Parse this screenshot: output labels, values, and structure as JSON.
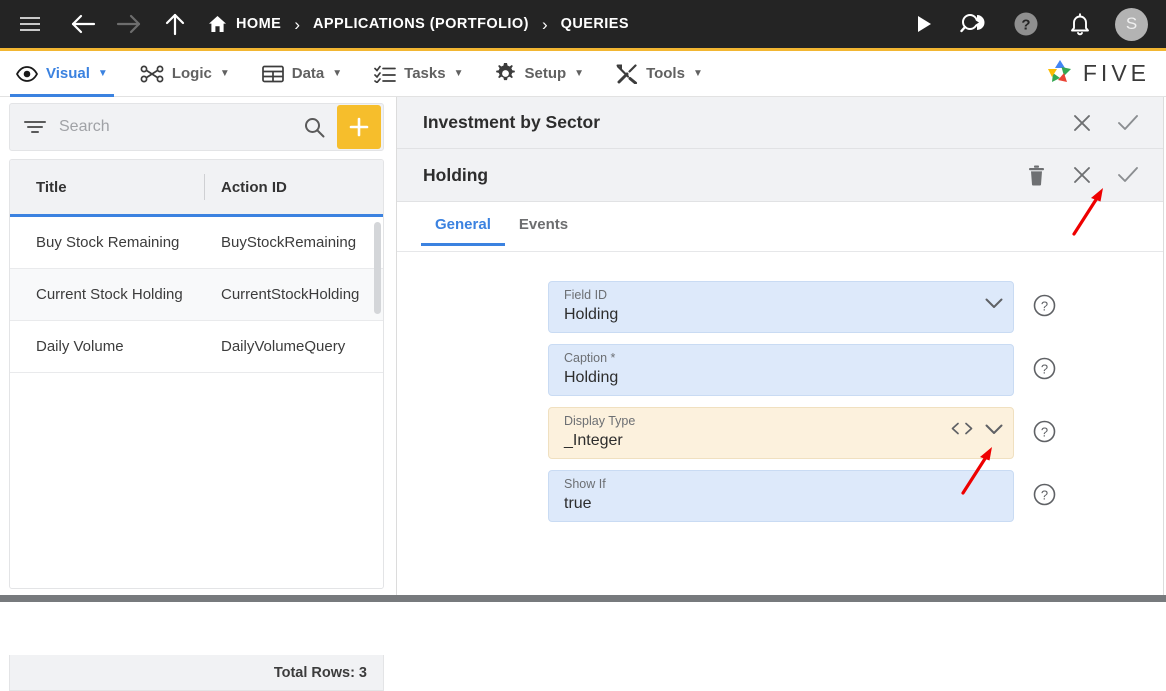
{
  "topbar": {
    "menu_icon": "hamburger-icon",
    "back_icon": "arrow-left-icon",
    "forward_icon": "arrow-right-icon",
    "up_icon": "arrow-up-icon",
    "home_label": "HOME",
    "separator": "›",
    "breadcrumb_2": "APPLICATIONS (PORTFOLIO)",
    "breadcrumb_3": "QUERIES",
    "run_icon": "play-icon",
    "debug_icon": "search-play-icon",
    "help_icon": "help-circle-icon",
    "notifications_icon": "bell-icon",
    "avatar_initial": "S"
  },
  "menubar": {
    "items": [
      {
        "label": "Visual",
        "icon": "eye-icon",
        "caret": "▼",
        "active": true
      },
      {
        "label": "Logic",
        "icon": "logic-nodes-icon",
        "caret": "▼",
        "active": false
      },
      {
        "label": "Data",
        "icon": "table-grid-icon",
        "caret": "▼",
        "active": false
      },
      {
        "label": "Tasks",
        "icon": "checklist-icon",
        "caret": "▼",
        "active": false
      },
      {
        "label": "Setup",
        "icon": "gear-icon",
        "caret": "▼",
        "active": false
      },
      {
        "label": "Tools",
        "icon": "tools-icon",
        "caret": "▼",
        "active": false
      }
    ],
    "brand": "FIVE"
  },
  "sidebar": {
    "search": {
      "placeholder": "Search",
      "value": "",
      "filter_icon": "filter-icon",
      "search_icon": "magnifier-icon"
    },
    "add_button_label": "+",
    "table": {
      "columns": [
        "Title",
        "Action ID"
      ],
      "rows": [
        {
          "title": "Buy Stock Remaining",
          "action_id": "BuyStockRemaining"
        },
        {
          "title": "Current Stock Holding",
          "action_id": "CurrentStockHolding"
        },
        {
          "title": "Daily Volume",
          "action_id": "DailyVolumeQuery"
        }
      ]
    },
    "total_rows": "Total Rows: 3"
  },
  "detail": {
    "outer_header": {
      "title": "Investment by Sector",
      "close_icon": "close-x-icon",
      "confirm_icon": "check-icon"
    },
    "inner_header": {
      "title": "Holding",
      "delete_icon": "trash-icon",
      "close_icon": "close-x-icon",
      "confirm_icon": "check-icon"
    },
    "tabs": [
      {
        "label": "General",
        "active": true
      },
      {
        "label": "Events",
        "active": false
      }
    ],
    "fields": [
      {
        "label": "Field ID",
        "value": "Holding",
        "style": "blue",
        "dropdown": true,
        "code": false,
        "help": true
      },
      {
        "label": "Caption *",
        "value": "Holding",
        "style": "blue",
        "dropdown": false,
        "code": false,
        "help": true
      },
      {
        "label": "Display Type",
        "value": "_Integer",
        "style": "highlight",
        "dropdown": true,
        "code": true,
        "help": true
      },
      {
        "label": "Show If",
        "value": "true",
        "style": "blue",
        "dropdown": false,
        "code": false,
        "help": true
      }
    ]
  },
  "annotations": {
    "arrow_color": "#ee0000",
    "arrow_to_confirm": "arrow pointing to confirm check in Holding header",
    "arrow_to_display_type_dropdown": "arrow pointing to Display Type dropdown chevron"
  },
  "colors": {
    "topbar_bg": "#242424",
    "accent_yellow": "#f2b632",
    "accent_blue": "#3b82e0",
    "field_blue": "#dde9fa",
    "field_highlight": "#fcf1dd",
    "panel_grey": "#f1f2f4"
  }
}
